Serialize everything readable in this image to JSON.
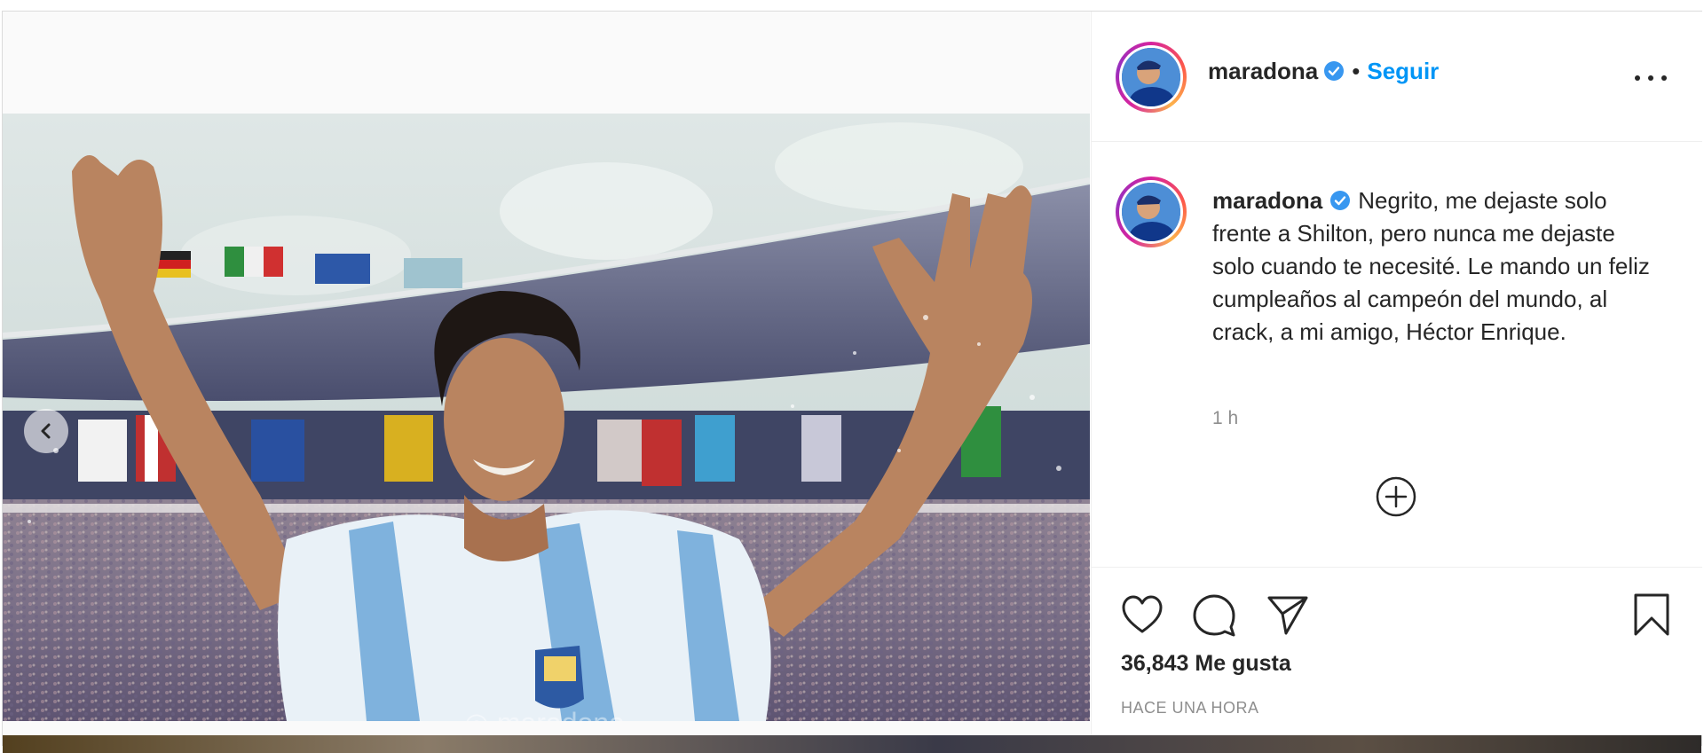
{
  "post": {
    "username": "maradona",
    "verified": true,
    "separator": "•",
    "follow_label": "Seguir",
    "more_icon": "more-options-icon",
    "caption": "Negrito, me dejaste solo frente a Shilton, pero nunca me dejaste solo cuando te necesité. Le mando un feliz cumpleaños al campeón del mundo, al crack, a mi amigo, Héctor Enrique.",
    "timestamp": "1 h",
    "likes": "36,843 Me gusta",
    "posted_ago": "HACE UNA HORA",
    "watermark": "◎ maradona",
    "icons": {
      "prev": "chevron-left-icon",
      "load_more": "plus-circle-icon",
      "like": "heart-icon",
      "comment": "comment-icon",
      "share": "paper-plane-icon",
      "save": "bookmark-icon",
      "verified": "verified-badge-icon"
    },
    "colors": {
      "link_blue": "#0095f6",
      "verified_blue": "#3897f0",
      "text": "#262626",
      "muted": "#8e8e8e"
    }
  }
}
